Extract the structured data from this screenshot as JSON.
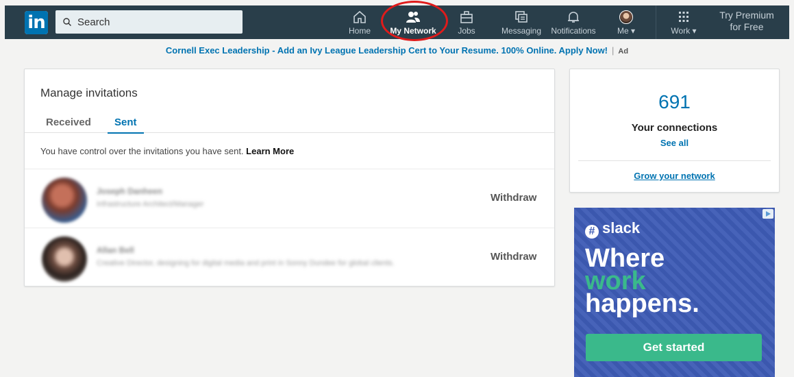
{
  "nav": {
    "logo_text": "in",
    "search_placeholder": "Search",
    "items": [
      {
        "label": "Home",
        "icon": "home-icon"
      },
      {
        "label": "My Network",
        "icon": "people-icon"
      },
      {
        "label": "Jobs",
        "icon": "briefcase-icon"
      },
      {
        "label": "Messaging",
        "icon": "messaging-icon"
      },
      {
        "label": "Notifications",
        "icon": "bell-icon"
      },
      {
        "label": "Me ▾",
        "icon": "avatar"
      },
      {
        "label": "Work ▾",
        "icon": "grid-icon"
      }
    ],
    "premium_line1": "Try Premium",
    "premium_line2": "for Free",
    "active_color": "#ffffff",
    "bar_color": "#293e4a"
  },
  "ad_banner": {
    "text": "Cornell Exec Leadership - Add an Ivy League Leadership Cert to Your Resume. 100% Online. Apply Now!",
    "separator": "|",
    "tag": "Ad"
  },
  "invitations": {
    "title": "Manage invitations",
    "tabs": [
      {
        "label": "Received",
        "active": false
      },
      {
        "label": "Sent",
        "active": true
      }
    ],
    "notice": "You have control over the invitations you have sent.",
    "notice_link": "Learn More",
    "rows": [
      {
        "name": "Joseph Danheen",
        "subtitle": "Infrastructure Architect/Manager",
        "action": "Withdraw"
      },
      {
        "name": "Allan Bell",
        "subtitle": "Creative Director, designing for digital media and print in Sonny Dundee for global clients.",
        "action": "Withdraw"
      }
    ]
  },
  "connections": {
    "count": "691",
    "label": "Your connections",
    "see_all": "See all",
    "grow": "Grow your network"
  },
  "slack_ad": {
    "brand": "slack",
    "line1": "Where",
    "line2": "work",
    "line3": "happens.",
    "cta": "Get started",
    "bg_color": "#3d5bb5",
    "accent_color": "#3ab98b"
  }
}
